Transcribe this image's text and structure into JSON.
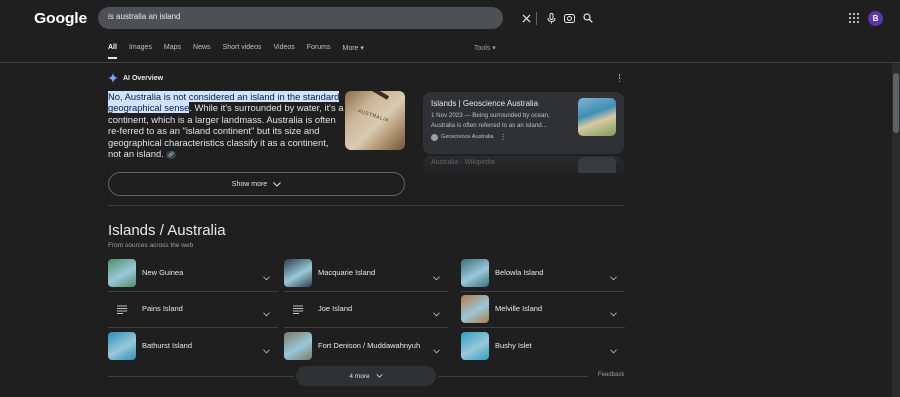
{
  "header": {
    "logo_text": "Google",
    "search_query": "is australia an island",
    "avatar_letter": "B"
  },
  "tabs": [
    {
      "label": "All",
      "active": true
    },
    {
      "label": "Images"
    },
    {
      "label": "Maps"
    },
    {
      "label": "News"
    },
    {
      "label": "Short videos"
    },
    {
      "label": "Videos"
    },
    {
      "label": "Forums"
    },
    {
      "label": "More"
    }
  ],
  "tools_label": "Tools",
  "ai_overview": {
    "heading": "AI Overview",
    "highlight": "No, Australia is not considered an island in the standard geographical sense",
    "body": ". While it's surrounded by water, it's a continent, which is a larger landmass. Australia is often re-ferred to as an \"island continent\" but its size and geographical characteristics classify it as a continent, not an island.",
    "image_label": "AUSTRALIA",
    "show_more": "Show more",
    "sources": [
      {
        "title": "Islands | Geoscience Australia",
        "snippet": "1 Nov 2023 — Being surrounded by ocean, Australia is often referred to as an island...",
        "site": "Geoscience Australia"
      },
      {
        "title": "Australia - Wikipedia"
      }
    ]
  },
  "islands_section": {
    "title": "Islands / Australia",
    "subtitle": "From sources across the web",
    "items": [
      {
        "name": "New Guinea",
        "thumb": "#4f8f6a"
      },
      {
        "name": "Macquarie Island",
        "thumb": "#2f3f4f"
      },
      {
        "name": "Belowla Island",
        "thumb": "#3b6d7d"
      },
      {
        "name": "Pains Island",
        "thumb": "doc"
      },
      {
        "name": "Joe Island",
        "thumb": "doc"
      },
      {
        "name": "Melville Island",
        "thumb": "#b07a4a"
      },
      {
        "name": "Bathurst Island",
        "thumb": "#2a8fb8"
      },
      {
        "name": "Fort Denison / Muddawahnyuh",
        "thumb": "#7a7a6a"
      },
      {
        "name": "Bushy Islet",
        "thumb": "#2f9fc4"
      }
    ],
    "more_label": "4 more",
    "feedback_label": "Feedback"
  },
  "colors": {
    "background": "#1f1f1f",
    "highlight_bg": "#d3e3fd",
    "avatar": "#5e35b1"
  }
}
